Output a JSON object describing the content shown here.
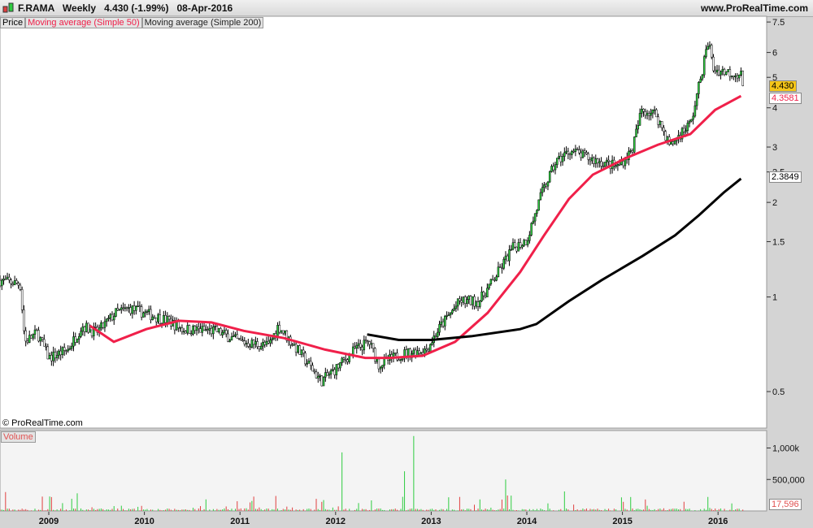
{
  "header": {
    "symbol": "F.RAMA",
    "period": "Weekly",
    "last": "4.430 (-1.99%)",
    "date": "08-Apr-2016",
    "site": "www.ProRealTime.com"
  },
  "legend": {
    "price": "Price",
    "ma50": "Moving average (Simple 50)",
    "ma200": "Moving average (Simple 200)"
  },
  "copyright": "© ProRealTime.com",
  "volume_label": "Volume",
  "colors": {
    "ma50": "#f0204a",
    "ma200": "#000000",
    "up": "#2ecc40",
    "down": "#e04040",
    "last_tag": "#f5c518"
  },
  "chart_data": {
    "type": "candlestick",
    "price_axis": {
      "scale": "log",
      "ticks": [
        "7.5",
        "6",
        "5",
        "4",
        "3",
        "2.5",
        "2",
        "1.5",
        "1",
        "0.5"
      ],
      "range": [
        0.42,
        7.9
      ]
    },
    "x_ticks": [
      "2009",
      "2010",
      "2011",
      "2012",
      "2013",
      "2014",
      "2015",
      "2016"
    ],
    "last_price": "4.430",
    "ma50_last": "4.3581",
    "ma200_last": "2.3849",
    "price_path": [
      [
        2008.49,
        1.13
      ],
      [
        2008.7,
        1.1
      ],
      [
        2008.75,
        0.72
      ],
      [
        2008.88,
        0.77
      ],
      [
        2009.0,
        0.64
      ],
      [
        2009.2,
        0.68
      ],
      [
        2009.35,
        0.81
      ],
      [
        2009.5,
        0.77
      ],
      [
        2009.7,
        0.89
      ],
      [
        2009.85,
        0.92
      ],
      [
        2010.0,
        0.89
      ],
      [
        2010.25,
        0.84
      ],
      [
        2010.4,
        0.79
      ],
      [
        2010.75,
        0.78
      ],
      [
        2011.0,
        0.72
      ],
      [
        2011.3,
        0.7
      ],
      [
        2011.4,
        0.81
      ],
      [
        2011.6,
        0.68
      ],
      [
        2011.85,
        0.54
      ],
      [
        2012.0,
        0.59
      ],
      [
        2012.2,
        0.68
      ],
      [
        2012.35,
        0.72
      ],
      [
        2012.45,
        0.61
      ],
      [
        2012.7,
        0.66
      ],
      [
        2012.95,
        0.68
      ],
      [
        2013.1,
        0.81
      ],
      [
        2013.3,
        0.97
      ],
      [
        2013.5,
        0.97
      ],
      [
        2013.65,
        1.13
      ],
      [
        2013.85,
        1.43
      ],
      [
        2014.0,
        1.52
      ],
      [
        2014.15,
        2.11
      ],
      [
        2014.3,
        2.68
      ],
      [
        2014.45,
        2.93
      ],
      [
        2014.65,
        2.76
      ],
      [
        2014.95,
        2.6
      ],
      [
        2015.1,
        2.93
      ],
      [
        2015.2,
        3.94
      ],
      [
        2015.35,
        3.83
      ],
      [
        2015.5,
        3.02
      ],
      [
        2015.6,
        3.3
      ],
      [
        2015.72,
        3.6
      ],
      [
        2015.8,
        4.7
      ],
      [
        2015.9,
        6.55
      ],
      [
        2015.95,
        5.3
      ],
      [
        2016.1,
        5.2
      ],
      [
        2016.25,
        5.1
      ],
      [
        2016.27,
        4.43
      ]
    ],
    "ma50": [
      [
        2009.43,
        0.81
      ],
      [
        2009.68,
        0.72
      ],
      [
        2010.02,
        0.79
      ],
      [
        2010.36,
        0.84
      ],
      [
        2010.7,
        0.83
      ],
      [
        2011.04,
        0.78
      ],
      [
        2011.46,
        0.74
      ],
      [
        2011.89,
        0.68
      ],
      [
        2012.31,
        0.64
      ],
      [
        2012.57,
        0.64
      ],
      [
        2012.91,
        0.65
      ],
      [
        2013.25,
        0.72
      ],
      [
        2013.59,
        0.89
      ],
      [
        2013.93,
        1.2
      ],
      [
        2014.18,
        1.57
      ],
      [
        2014.44,
        2.05
      ],
      [
        2014.69,
        2.45
      ],
      [
        2015.03,
        2.76
      ],
      [
        2015.37,
        3.05
      ],
      [
        2015.71,
        3.3
      ],
      [
        2015.97,
        3.94
      ],
      [
        2016.24,
        4.36
      ]
    ],
    "ma200": [
      [
        2012.33,
        0.76
      ],
      [
        2012.66,
        0.73
      ],
      [
        2013.0,
        0.73
      ],
      [
        2013.42,
        0.75
      ],
      [
        2013.93,
        0.79
      ],
      [
        2014.1,
        0.82
      ],
      [
        2014.44,
        0.97
      ],
      [
        2014.78,
        1.13
      ],
      [
        2015.21,
        1.35
      ],
      [
        2015.55,
        1.57
      ],
      [
        2015.8,
        1.82
      ],
      [
        2016.06,
        2.15
      ],
      [
        2016.24,
        2.38
      ]
    ],
    "volume_axis": {
      "ticks": [
        "1,000k",
        "500,000"
      ],
      "last": "17,596"
    },
    "volume_spikes": [
      [
        2012.07,
        930000
      ],
      [
        2012.73,
        630000
      ],
      [
        2012.81,
        1190000
      ],
      [
        2013.78,
        500000
      ],
      [
        2014.4,
        310000
      ],
      [
        2009.3,
        280000
      ],
      [
        2008.55,
        300000
      ]
    ]
  }
}
